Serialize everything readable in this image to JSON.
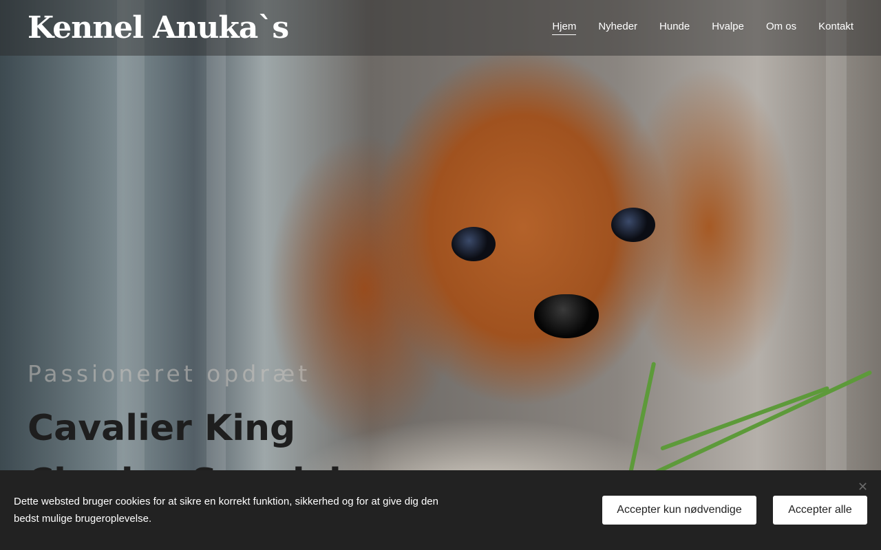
{
  "site": {
    "logo": "Kennel Anuka`s"
  },
  "nav": {
    "items": [
      {
        "label": "Hjem",
        "active": true
      },
      {
        "label": "Nyheder"
      },
      {
        "label": "Hunde"
      },
      {
        "label": "Hvalpe"
      },
      {
        "label": "Om os"
      },
      {
        "label": "Kontakt"
      }
    ]
  },
  "hero": {
    "tagline": "Passioneret opdræt",
    "headline": "Cavalier King Charles Spaniel"
  },
  "cookie": {
    "text": "Dette websted bruger cookies for at sikre en korrekt funktion, sikkerhed og for at give dig den bedst mulige brugeroplevelse.",
    "close_icon": "close-icon",
    "necessary_label": "Accepter kun nødvendige",
    "accept_all_label": "Accepter alle"
  },
  "colors": {
    "cookie_bar": "#222222",
    "header_overlay": "rgba(40,40,40,0.45)"
  }
}
